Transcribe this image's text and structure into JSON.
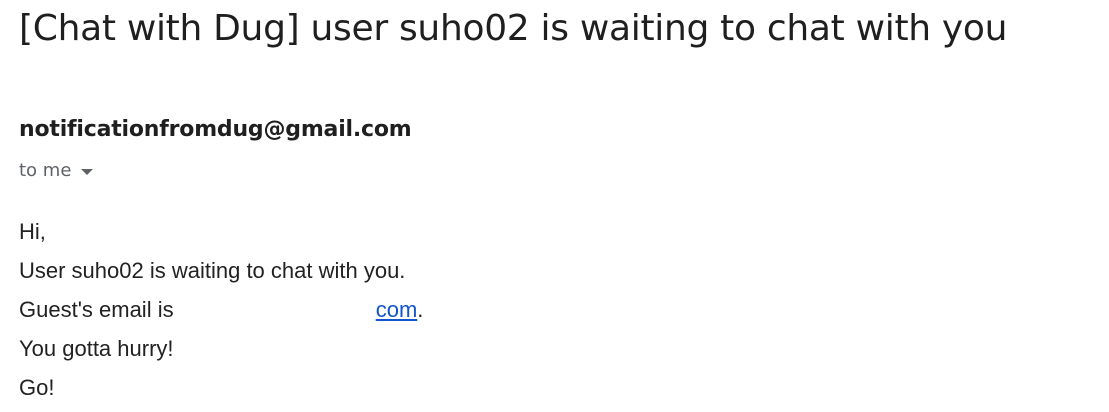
{
  "email": {
    "subject": "[Chat with Dug] user suho02 is waiting to chat with you",
    "sender": "notificationfromdug@gmail.com",
    "recipient_label": "to me",
    "recipient_toggle_icon": "caret-down-icon",
    "body": {
      "greeting": "Hi,",
      "line1": "User suho02 is waiting to chat with you.",
      "line2_prefix": "Guest's email is",
      "line2_link": "com",
      "line2_suffix": ".",
      "line3": "You gotta hurry!",
      "line4": "Go!"
    }
  },
  "colors": {
    "link": "#1155cc",
    "secondary_text": "#5f6368",
    "primary_text": "#1f1f1f"
  }
}
